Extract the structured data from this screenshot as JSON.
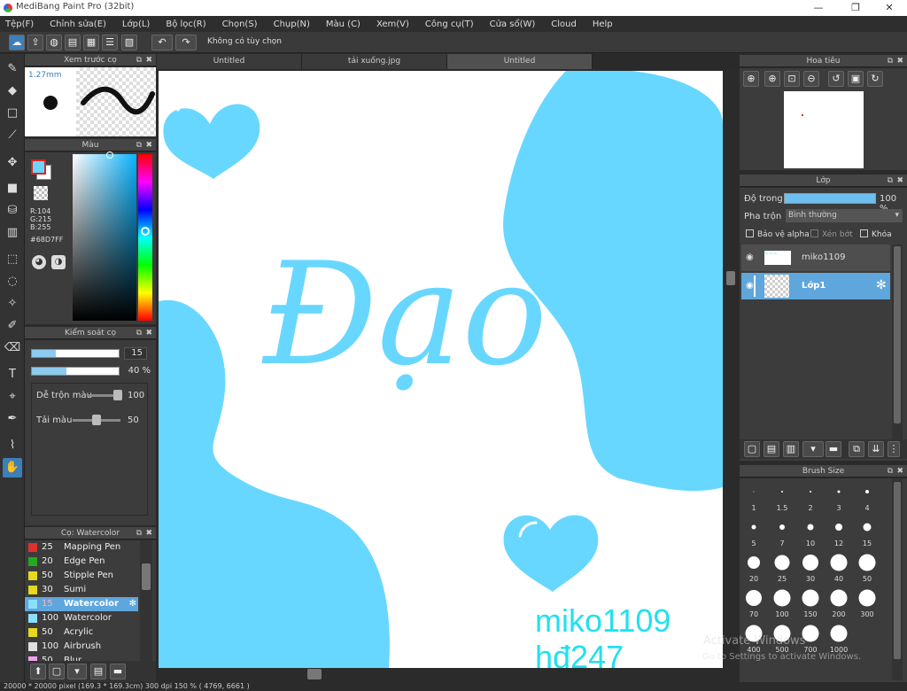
{
  "app": {
    "title": "MediBang Paint Pro (32bit)"
  },
  "menu": [
    "Tệp(F)",
    "Chỉnh sửa(E)",
    "Lớp(L)",
    "Bộ lọc(R)",
    "Chọn(S)",
    "Chụp(N)",
    "Màu (C)",
    "Xem(V)",
    "Công cụ(T)",
    "Cửa sổ(W)",
    "Cloud",
    "Help"
  ],
  "toolbar": {
    "option_label": "Không có tùy chọn"
  },
  "tabs": [
    "Untitled",
    "tải xuống.jpg",
    "Untitled"
  ],
  "brush_preview": {
    "title": "Xem trước cọ",
    "size": "1.27mm"
  },
  "color_panel": {
    "title": "Màu",
    "r": "R:104",
    "g": "G:215",
    "b": "B:255",
    "hex": "#68D7FF",
    "fg_color": "#68D7FF"
  },
  "brush_control": {
    "title": "Kiểm soát cọ",
    "size_value": "15",
    "opacity_value": "40 %",
    "mix_label": "Dễ trộn màu",
    "mix_value": "100",
    "load_label": "Tải màu",
    "load_value": "50"
  },
  "brush_list": {
    "title": "Cọ: Watercolor",
    "items": [
      {
        "size": "25",
        "name": "Mapping Pen",
        "color": "#e03030"
      },
      {
        "size": "20",
        "name": "Edge Pen",
        "color": "#22aa22"
      },
      {
        "size": "50",
        "name": "Stipple Pen",
        "color": "#e6d820"
      },
      {
        "size": "30",
        "name": "Sumi",
        "color": "#e6d820"
      },
      {
        "size": "15",
        "name": "Watercolor",
        "color": "#8adfff"
      },
      {
        "size": "100",
        "name": "Watercolor (Wet)",
        "color": "#8adfff"
      },
      {
        "size": "50",
        "name": "Acrylic",
        "color": "#e6d820"
      },
      {
        "size": "100",
        "name": "Airbrush",
        "color": "#e0e0e0"
      },
      {
        "size": "50",
        "name": "Blur",
        "color": "#f0a0f0"
      }
    ]
  },
  "navigator": {
    "title": "Hoa tiêu"
  },
  "layers": {
    "title": "Lớp",
    "opacity_label": "Độ trong",
    "opacity_value": "100 %",
    "blend_label": "Pha trộn",
    "blend_value": "Bình thường",
    "protect_alpha": "Bảo vệ alpha",
    "clipping": "Xén bớt",
    "lock": "Khóa",
    "items": [
      {
        "name": "miko1109"
      },
      {
        "name": "Lớp1"
      }
    ]
  },
  "brush_size": {
    "title": "Brush Size",
    "sizes": [
      "1",
      "1.5",
      "2",
      "3",
      "4",
      "5",
      "7",
      "10",
      "12",
      "15",
      "20",
      "25",
      "30",
      "40",
      "50",
      "70",
      "100",
      "150",
      "200",
      "300",
      "400",
      "500",
      "700",
      "1000"
    ]
  },
  "artwork": {
    "word": "Đạo",
    "signature_line1": "miko1109",
    "signature_line2": "hđ247"
  },
  "watermark": {
    "line1": "Activate Windows",
    "line2": "Go to Settings to activate Windows."
  },
  "status": {
    "text": "20000 * 20000 pixel   (169.3 * 169.3cm)   300 dpi   150 %   ( 4769, 6661 )"
  }
}
